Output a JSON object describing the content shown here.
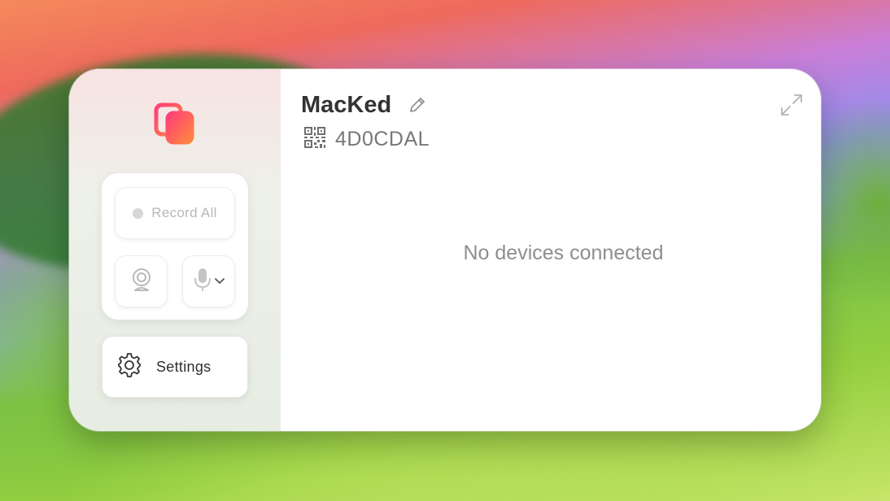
{
  "app": {
    "logo_icon": "stacked-screens-logo-icon",
    "brand_colors": [
      "#ff3d7a",
      "#ff8a3d"
    ]
  },
  "sidebar": {
    "record_all_label": "Record All",
    "record_indicator_color": "#d6d6d6",
    "camera_icon": "webcam-icon",
    "mic_icon": "microphone-icon",
    "mic_dropdown_icon": "chevron-down-icon",
    "settings_label": "Settings",
    "settings_icon": "gear-icon"
  },
  "main": {
    "device_name": "MacKed",
    "edit_icon": "pencil-icon",
    "code_icon": "qr-code-icon",
    "device_code": "4D0CDAL",
    "expand_icon": "expand-icon",
    "empty_state": "No devices connected"
  }
}
